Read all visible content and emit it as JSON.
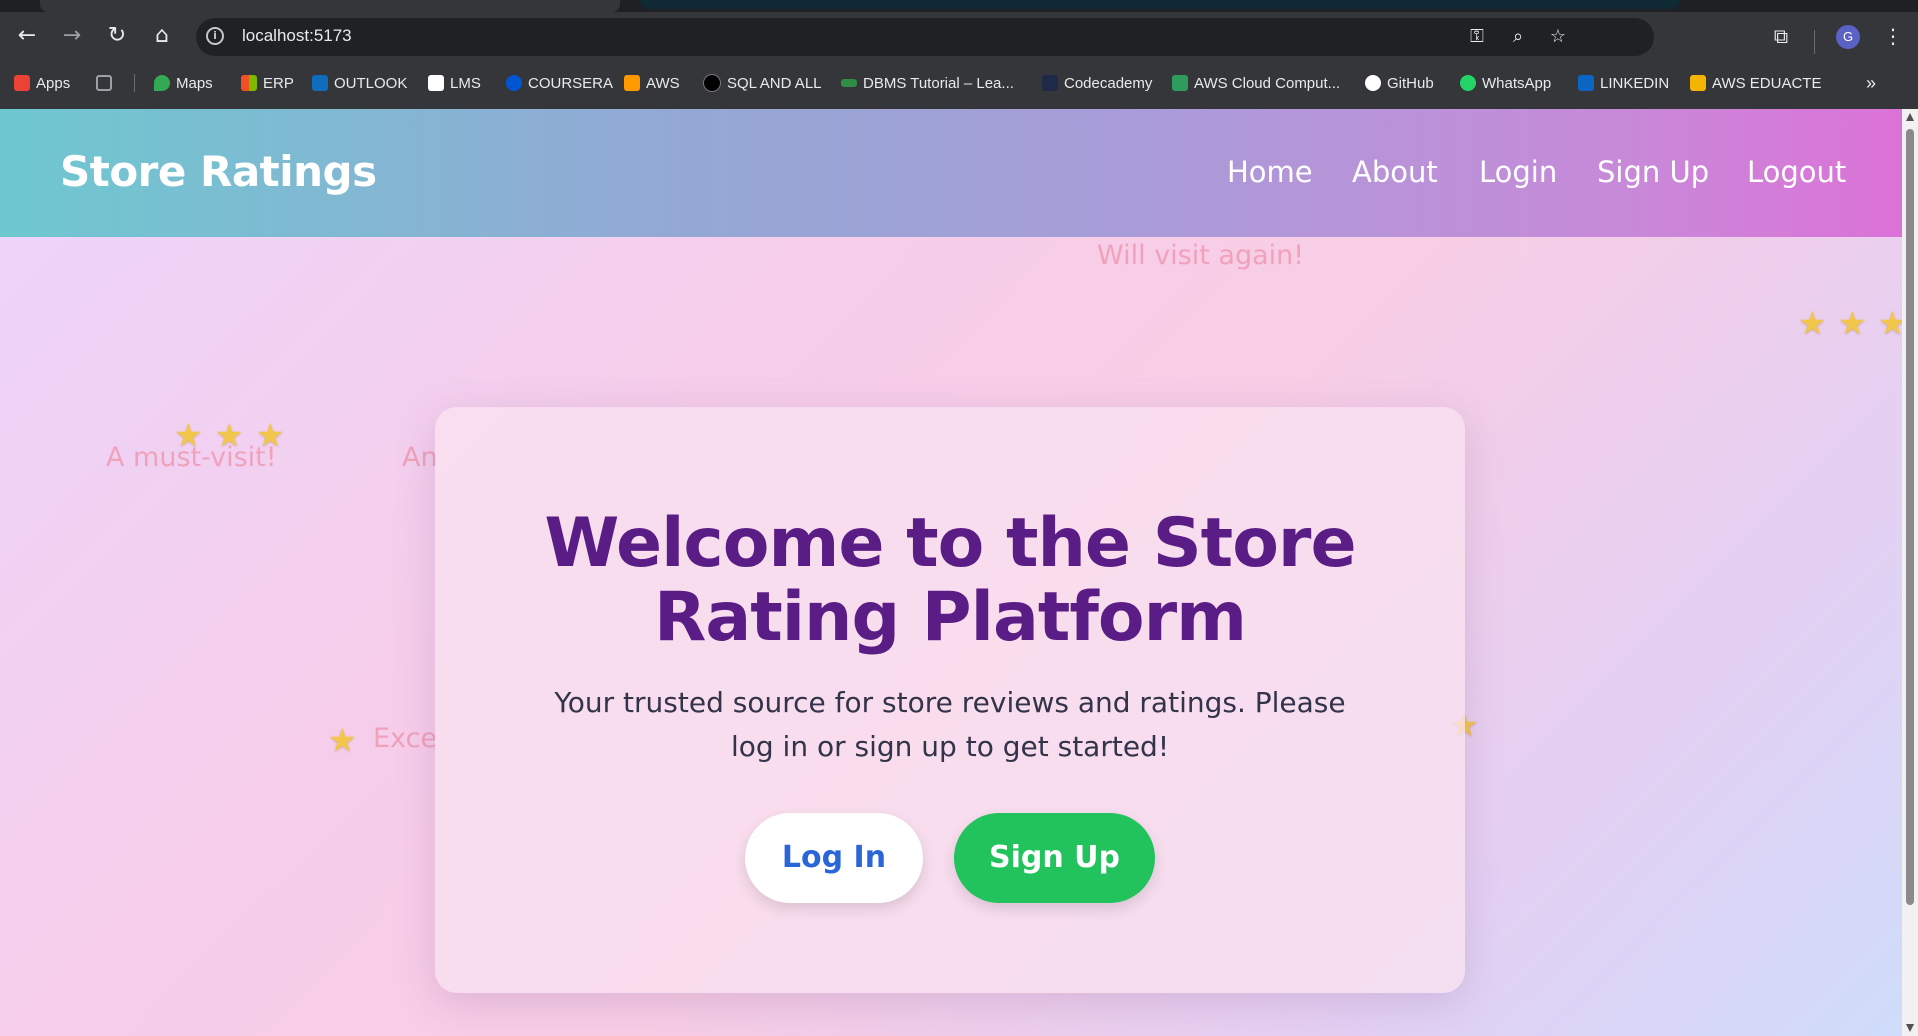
{
  "browser": {
    "url": "localhost:5173",
    "profile_initial": "G",
    "bookmarks": [
      {
        "label": "Apps",
        "color": "#ea4335"
      },
      {
        "label": "",
        "color": "#9aa0a6"
      },
      {
        "label": "Maps",
        "color": "#34a853"
      },
      {
        "label": "ERP",
        "color": "#f25022"
      },
      {
        "label": "OUTLOOK",
        "color": "#0f6cbd"
      },
      {
        "label": "LMS",
        "color": "#ffffff"
      },
      {
        "label": "COURSERA",
        "color": "#0056d2"
      },
      {
        "label": "AWS",
        "color": "#ff9900"
      },
      {
        "label": "SQL AND ALL",
        "color": "#000000"
      },
      {
        "label": "DBMS Tutorial – Lea...",
        "color": "#2f8d46"
      },
      {
        "label": "Codecademy",
        "color": "#1f2a48"
      },
      {
        "label": "AWS Cloud Comput...",
        "color": "#2e9c5e"
      },
      {
        "label": "GitHub",
        "color": "#ffffff"
      },
      {
        "label": "WhatsApp",
        "color": "#25d366"
      },
      {
        "label": "LINKEDIN",
        "color": "#0a66c2"
      },
      {
        "label": "AWS EDUACTE",
        "color": "#f5b400"
      }
    ],
    "more_bookmarks": "»"
  },
  "navbar": {
    "brand": "Store Ratings",
    "links": [
      "Home",
      "About",
      "Login",
      "Sign Up",
      "Logout"
    ]
  },
  "background": {
    "floating_texts": [
      "Will visit again!",
      "A must-visit!",
      "An",
      "Exce"
    ],
    "star_glyph": "★"
  },
  "hero": {
    "title": "Welcome to the Store Rating Platform",
    "subtitle": "Your trusted source for store reviews and ratings. Please log in or sign up to get started!",
    "login_button": "Log In",
    "signup_button": "Sign Up"
  },
  "colors": {
    "title": "#5a1d86",
    "login_text": "#2a66d8",
    "signup_bg": "#22c25c"
  }
}
